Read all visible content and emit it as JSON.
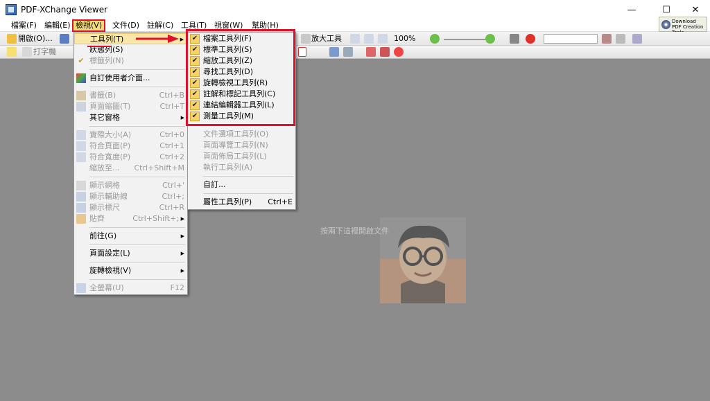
{
  "window": {
    "title": "PDF-XChange Viewer",
    "minimize": "—",
    "maximize": "☐",
    "close": "✕"
  },
  "menubar": {
    "items": [
      "檔案(F)",
      "編輯(E)",
      "檢視(V)",
      "文件(D)",
      "註解(C)",
      "工具(T)",
      "視窗(W)",
      "幫助(H)"
    ]
  },
  "promo": {
    "label": "Download PDF Creation Tools"
  },
  "toolbar": {
    "open_label": "開啟(O)...",
    "zoom_label": "放大工具",
    "zoom_value": "100%",
    "typewriter_label": "打字機"
  },
  "document": {
    "hint": "按兩下這裡開啟文件"
  },
  "view_menu": {
    "items": [
      {
        "label": "工具列(T)",
        "shortcut": "",
        "submenu": true,
        "disabled": false,
        "highlighted": true
      },
      {
        "label": "狀態列(S)",
        "shortcut": "",
        "submenu": false,
        "disabled": false
      },
      {
        "label": "標籤列(N)",
        "shortcut": "",
        "submenu": false,
        "disabled": true,
        "checked": true
      },
      {
        "label": "自訂使用者介面...",
        "shortcut": "",
        "submenu": false,
        "disabled": false
      },
      {
        "label": "書籤(B)",
        "shortcut": "Ctrl+B",
        "submenu": false,
        "disabled": true
      },
      {
        "label": "頁面縮圖(T)",
        "shortcut": "Ctrl+T",
        "submenu": false,
        "disabled": true
      },
      {
        "label": "其它窗格",
        "shortcut": "",
        "submenu": true,
        "disabled": false
      },
      {
        "label": "實際大小(A)",
        "shortcut": "Ctrl+0",
        "submenu": false,
        "disabled": true
      },
      {
        "label": "符合頁面(P)",
        "shortcut": "Ctrl+1",
        "submenu": false,
        "disabled": true
      },
      {
        "label": "符合寬度(P)",
        "shortcut": "Ctrl+2",
        "submenu": false,
        "disabled": true
      },
      {
        "label": "縮放至...",
        "shortcut": "Ctrl+Shift+M",
        "submenu": false,
        "disabled": true
      },
      {
        "label": "顯示網格",
        "shortcut": "Ctrl+'",
        "submenu": false,
        "disabled": true
      },
      {
        "label": "顯示輔助線",
        "shortcut": "Ctrl+;",
        "submenu": false,
        "disabled": true
      },
      {
        "label": "顯示標尺",
        "shortcut": "Ctrl+R",
        "submenu": false,
        "disabled": true
      },
      {
        "label": "貼齊",
        "shortcut": "Ctrl+Shift+;",
        "submenu": true,
        "disabled": true
      },
      {
        "label": "前往(G)",
        "shortcut": "",
        "submenu": true,
        "disabled": false
      },
      {
        "label": "頁面設定(L)",
        "shortcut": "",
        "submenu": true,
        "disabled": false
      },
      {
        "label": "旋轉檢視(V)",
        "shortcut": "",
        "submenu": true,
        "disabled": false
      },
      {
        "label": "全螢幕(U)",
        "shortcut": "F12",
        "submenu": false,
        "disabled": true
      }
    ]
  },
  "toolbars_submenu": {
    "items": [
      {
        "label": "檔案工具列(F)",
        "checked": true,
        "disabled": false,
        "shortcut": ""
      },
      {
        "label": "標準工具列(S)",
        "checked": true,
        "disabled": false,
        "shortcut": ""
      },
      {
        "label": "縮放工具列(Z)",
        "checked": true,
        "disabled": false,
        "shortcut": ""
      },
      {
        "label": "尋找工具列(D)",
        "checked": true,
        "disabled": false,
        "shortcut": ""
      },
      {
        "label": "旋轉檢視工具列(R)",
        "checked": true,
        "disabled": false,
        "shortcut": ""
      },
      {
        "label": "註解和標記工具列(C)",
        "checked": true,
        "disabled": false,
        "shortcut": ""
      },
      {
        "label": "連結編輯器工具列(L)",
        "checked": true,
        "disabled": false,
        "shortcut": ""
      },
      {
        "label": "測量工具列(M)",
        "checked": true,
        "disabled": false,
        "shortcut": ""
      },
      {
        "label": "文件選項工具列(O)",
        "checked": false,
        "disabled": true,
        "shortcut": ""
      },
      {
        "label": "頁面導覽工具列(N)",
        "checked": false,
        "disabled": true,
        "shortcut": ""
      },
      {
        "label": "頁面佈局工具列(L)",
        "checked": false,
        "disabled": true,
        "shortcut": ""
      },
      {
        "label": "執行工具列(A)",
        "checked": false,
        "disabled": true,
        "shortcut": ""
      },
      {
        "label": "自訂...",
        "checked": false,
        "disabled": false,
        "shortcut": ""
      },
      {
        "label": "屬性工具列(P)",
        "checked": false,
        "disabled": false,
        "shortcut": "Ctrl+E"
      }
    ]
  },
  "colors": {
    "highlight": "#e0102a",
    "menu_hover": "#fae7a8",
    "check": "#f6d26e"
  }
}
